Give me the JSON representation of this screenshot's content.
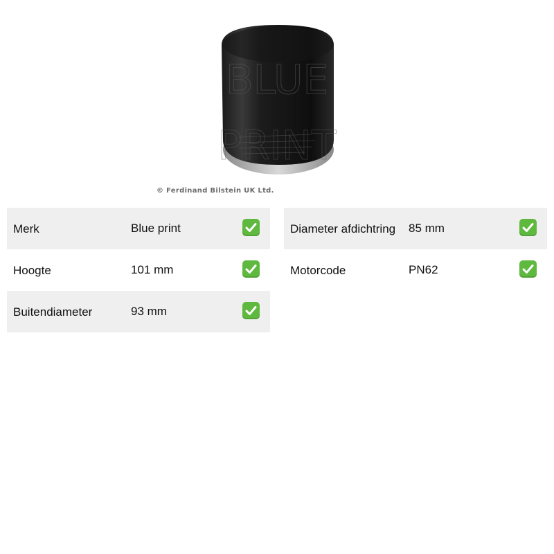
{
  "image": {
    "copyright": "© Ferdinand Bilstein UK Ltd.",
    "watermark_line1": "BLUE",
    "watermark_line2": "PRINT"
  },
  "specs": {
    "left": [
      {
        "label": "Merk",
        "value": "Blue print",
        "shaded": true
      },
      {
        "label": "Hoogte",
        "value": "101 mm",
        "shaded": false
      },
      {
        "label": "Buitendiameter",
        "value": "93 mm",
        "shaded": true
      }
    ],
    "right": [
      {
        "label": "Diameter afdichtring",
        "value": "85 mm",
        "shaded": true
      },
      {
        "label": "Motorcode",
        "value": "PN62",
        "shaded": false
      }
    ]
  },
  "colors": {
    "row_shade": "#efefef",
    "check_green": "#5fb93f"
  },
  "icons": {
    "check": "check-mark-button-icon"
  }
}
